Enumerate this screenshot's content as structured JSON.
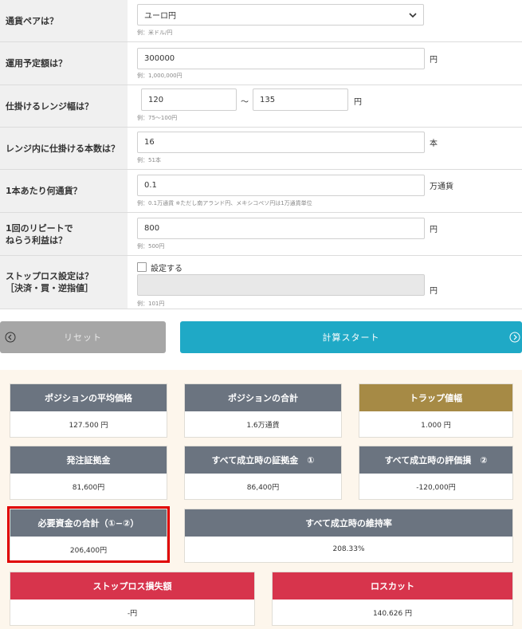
{
  "form": {
    "pair": {
      "label": "通貨ペアは？",
      "value": "ユーロ円",
      "example": "例：米ドル/円"
    },
    "amount": {
      "label": "運用予定額は？",
      "value": "300000",
      "unit": "円",
      "example": "例：1,000,000円"
    },
    "range": {
      "label": "仕掛けるレンジ幅は？",
      "low": "120",
      "sep": "〜",
      "high": "135",
      "unit": "円",
      "example": "例：75〜100円"
    },
    "count": {
      "label": "レンジ内に仕掛ける本数は？",
      "value": "16",
      "unit": "本",
      "example": "例：51本"
    },
    "per": {
      "label": "1本あたり何通貨？",
      "value": "0.1",
      "unit": "万通貨",
      "example": "例：0.1万通貨 ※ただし南アランド円、メキシコペソ円は1万通貨単位"
    },
    "profit": {
      "label_line1": "1回のリピートで",
      "label_line2": "ねらう利益は？",
      "value": "800",
      "unit": "円",
      "example": "例：500円"
    },
    "stop": {
      "label_line1": "ストップロス設定は？",
      "label_line2": "［決済・買・逆指値］",
      "checkbox_label": "設定する",
      "value": "",
      "unit": "円",
      "example": "例：101円"
    }
  },
  "buttons": {
    "reset": "リセット",
    "start": "計算スタート"
  },
  "results": {
    "avg_price": {
      "title": "ポジションの平均価格",
      "value": "127.500 円"
    },
    "total_position": {
      "title": "ポジションの合計",
      "value": "1.6万通貨"
    },
    "trap_width": {
      "title": "トラップ値幅",
      "value": "1.000 円"
    },
    "order_margin": {
      "title": "発注証拠金",
      "value": "81,600円"
    },
    "margin_all": {
      "title": "すべて成立時の証拠金　①",
      "value": "86,400円"
    },
    "loss_all": {
      "title": "すべて成立時の評価損　②",
      "value": "-120,000円"
    },
    "required": {
      "title": "必要資金の合計（①−②）",
      "value": "206,400円"
    },
    "maintenance": {
      "title": "すべて成立時の維持率",
      "value": "208.33%"
    },
    "stoploss": {
      "title": "ストップロス損失額",
      "value": "-円"
    },
    "losscut": {
      "title": "ロスカット",
      "value": "140.626 円"
    }
  },
  "colors": {
    "accent": "#1fa9c6",
    "card_gray": "#6b7480",
    "card_gold": "#a68a45",
    "card_red": "#d7344c",
    "highlight": "#e00000"
  }
}
